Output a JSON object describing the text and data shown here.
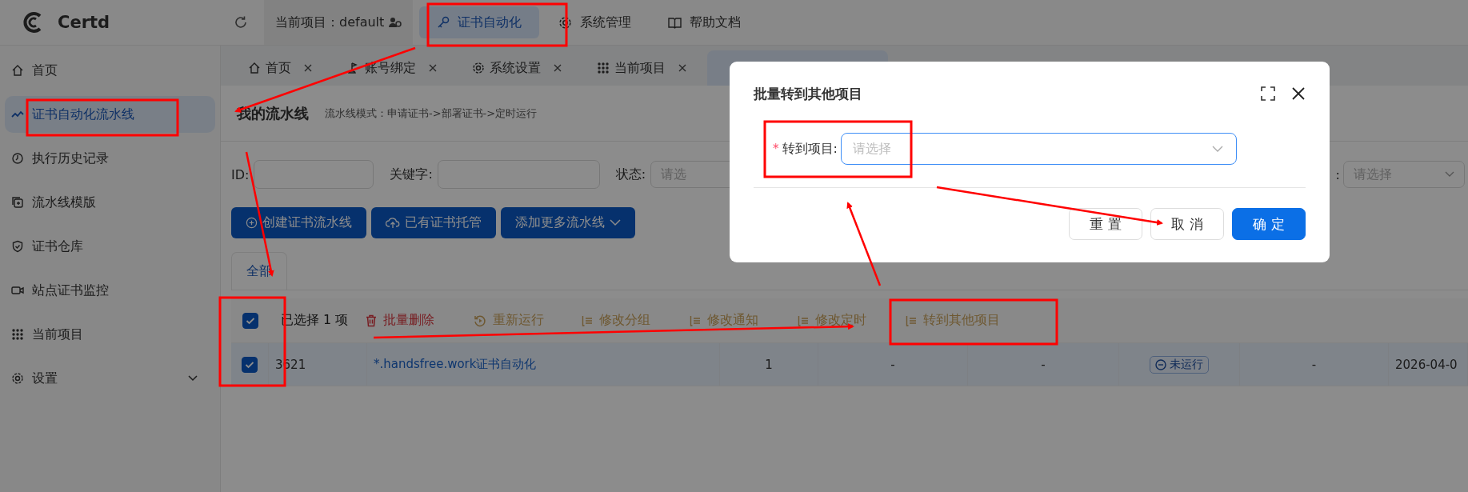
{
  "header": {
    "logo": "Certd",
    "project_label": "当前项目：default",
    "nav": [
      {
        "label": "证书自动化",
        "selected": true
      },
      {
        "label": "系统管理",
        "selected": false
      },
      {
        "label": "帮助文档",
        "selected": false
      }
    ]
  },
  "sidebar": {
    "items": [
      {
        "label": "首页",
        "selected": false,
        "expandable": false
      },
      {
        "label": "证书自动化流水线",
        "selected": true,
        "expandable": false
      },
      {
        "label": "执行历史记录",
        "selected": false,
        "expandable": false
      },
      {
        "label": "流水线模版",
        "selected": false,
        "expandable": false
      },
      {
        "label": "证书仓库",
        "selected": false,
        "expandable": false
      },
      {
        "label": "站点证书监控",
        "selected": false,
        "expandable": false
      },
      {
        "label": "当前项目",
        "selected": false,
        "expandable": false
      },
      {
        "label": "设置",
        "selected": false,
        "expandable": true
      }
    ]
  },
  "tabs": [
    {
      "label": "首页",
      "selected": false
    },
    {
      "label": "账号绑定",
      "selected": false
    },
    {
      "label": "系统设置",
      "selected": false
    },
    {
      "label": "当前项目",
      "selected": false
    },
    {
      "selected": true
    }
  ],
  "page": {
    "title": "我的流水线",
    "subtitle": "流水线模式：申请证书->部署证书->定时运行"
  },
  "filters": [
    {
      "label": "ID:",
      "kind": "input"
    },
    {
      "label": "关键字:",
      "kind": "input"
    },
    {
      "label": "状态:",
      "kind": "select",
      "placeholder": "请选"
    },
    {
      "label": ":",
      "kind": "select",
      "placeholder": "请选择"
    }
  ],
  "buttons": [
    {
      "label": "创建证书流水线",
      "kind": "create"
    },
    {
      "label": "已有证书托管",
      "kind": "upload"
    },
    {
      "label": "添加更多流水线",
      "kind": "dropdown"
    }
  ],
  "group_tabs": [
    {
      "label": "全部",
      "selected": true
    }
  ],
  "batch_bar": {
    "checked": true,
    "selected_count": "已选择 1 项",
    "actions": [
      {
        "label": "批量删除",
        "kind": "danger"
      },
      {
        "label": "重新运行",
        "kind": "rerun"
      },
      {
        "label": "修改分组",
        "kind": "edit"
      },
      {
        "label": "修改通知",
        "kind": "edit"
      },
      {
        "label": "修改定时",
        "kind": "edit"
      },
      {
        "label": "转到其他项目",
        "kind": "edit"
      }
    ]
  },
  "table": {
    "rows": [
      {
        "selected": true,
        "id": "3621",
        "title": "*.handsfree.work证书自动化",
        "column_4": "1",
        "column_5": "-",
        "column_6": "-",
        "status": "未运行",
        "column_8": "-",
        "column_9": "2026-04-0"
      }
    ]
  },
  "dialog": {
    "title": "批量转到其他项目",
    "field": {
      "required_mark": "*",
      "label": "转到项目:",
      "placeholder": "请选择"
    },
    "buttons": [
      {
        "label": "重 置",
        "kind": "default"
      },
      {
        "label": "取 消",
        "kind": "default"
      },
      {
        "label": "确 定",
        "kind": "primary"
      }
    ]
  }
}
